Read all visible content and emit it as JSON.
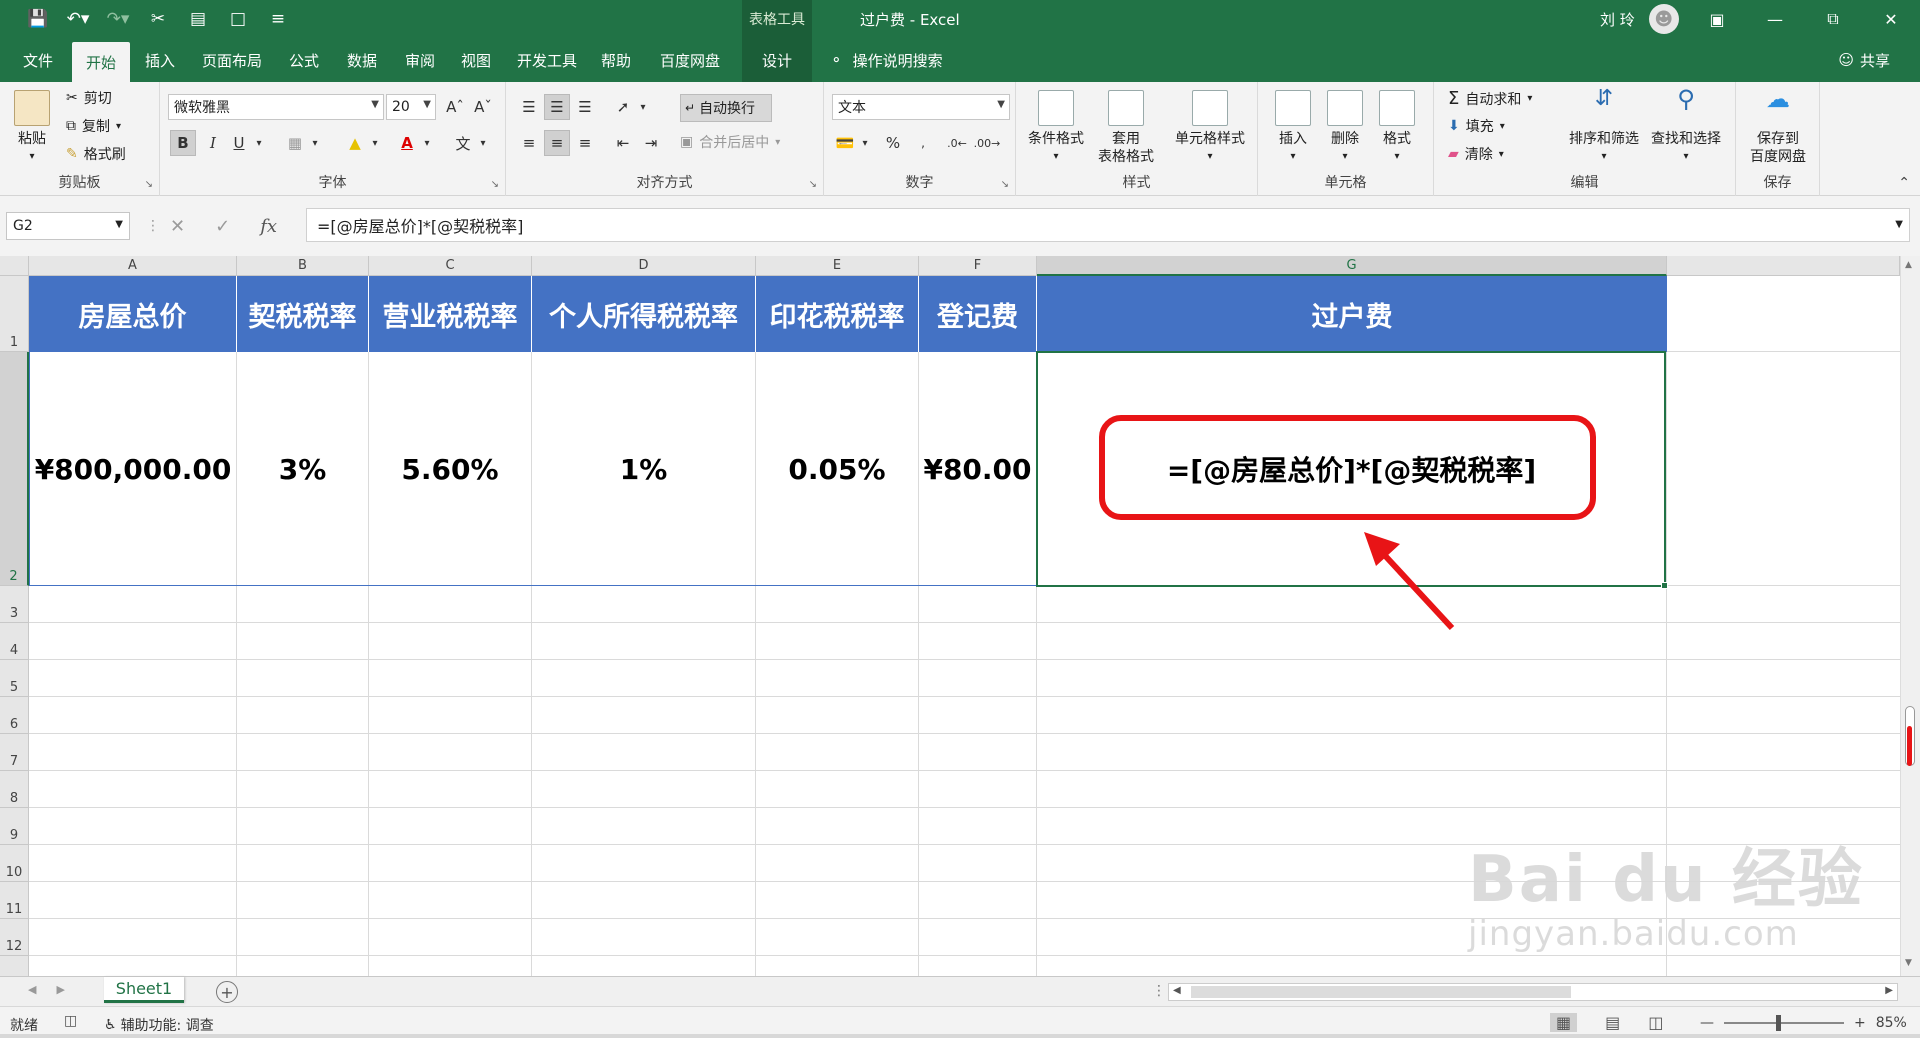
{
  "window": {
    "title": "过户费 - Excel",
    "context_tool": "表格工具",
    "user_name": "刘 玲",
    "controls": [
      "ribbon-display-options",
      "minimize",
      "restore",
      "close"
    ]
  },
  "qat": {
    "icons": [
      "save-icon",
      "undo-icon",
      "redo-icon",
      "cut-icon",
      "form-icon",
      "new-file-icon",
      "customize-qat-icon"
    ]
  },
  "tabs": [
    {
      "label": "文件",
      "active": false
    },
    {
      "label": "开始",
      "active": true
    },
    {
      "label": "插入",
      "active": false
    },
    {
      "label": "页面布局",
      "active": false
    },
    {
      "label": "公式",
      "active": false
    },
    {
      "label": "数据",
      "active": false
    },
    {
      "label": "审阅",
      "active": false
    },
    {
      "label": "视图",
      "active": false
    },
    {
      "label": "开发工具",
      "active": false
    },
    {
      "label": "帮助",
      "active": false
    },
    {
      "label": "百度网盘",
      "active": false
    },
    {
      "label": "设计",
      "active": false
    }
  ],
  "tell_me": "操作说明搜索",
  "share": "共享",
  "ribbon": {
    "clipboard": {
      "label": "剪贴板",
      "paste": "粘贴",
      "cut": "剪切",
      "copy": "复制",
      "format_painter": "格式刷"
    },
    "font": {
      "label": "字体",
      "font_name": "微软雅黑",
      "font_size": "20"
    },
    "alignment": {
      "label": "对齐方式",
      "wrap_text": "自动换行",
      "merge_center": "合并后居中"
    },
    "number": {
      "label": "数字",
      "format": "文本"
    },
    "styles": {
      "label": "样式",
      "conditional": "条件格式",
      "table_format_1": "套用",
      "table_format_2": "表格格式",
      "cell_styles": "单元格样式"
    },
    "cells": {
      "label": "单元格",
      "insert": "插入",
      "delete": "删除",
      "format": "格式"
    },
    "editing": {
      "label": "编辑",
      "autosum": "自动求和",
      "fill": "填充",
      "clear": "清除",
      "sort_filter": "排序和筛选",
      "find_select": "查找和选择"
    },
    "save": {
      "label": "保存",
      "save_to_1": "保存到",
      "save_to_2": "百度网盘"
    }
  },
  "formula_bar": {
    "name_box": "G2",
    "formula": "=[@房屋总价]*[@契税税率]"
  },
  "sheet": {
    "columns": [
      "A",
      "B",
      "C",
      "D",
      "E",
      "F",
      "G"
    ],
    "rows": [
      "1",
      "2",
      "3",
      "4",
      "5",
      "6",
      "7",
      "8",
      "9",
      "10",
      "11",
      "12"
    ],
    "selected_col": "G",
    "selected_row": "2",
    "headers": [
      "房屋总价",
      "契税税率",
      "营业税税率",
      "个人所得税税率",
      "印花税税率",
      "登记费",
      "过户费"
    ],
    "values": [
      "¥800,000.00",
      "3%",
      "5.60%",
      "1%",
      "0.05%",
      "¥80.00",
      "=[@房屋总价]*[@契税税率]"
    ],
    "header_color": "#4472c4",
    "highlight_color": "#e81416"
  },
  "sheet_tabs": {
    "active": "Sheet1"
  },
  "status": {
    "ready": "就绪",
    "accessibility": "辅助功能: 调查",
    "zoom": "85%"
  },
  "watermark": {
    "main": "Bai du 经验",
    "sub": "jingyan.baidu.com"
  }
}
